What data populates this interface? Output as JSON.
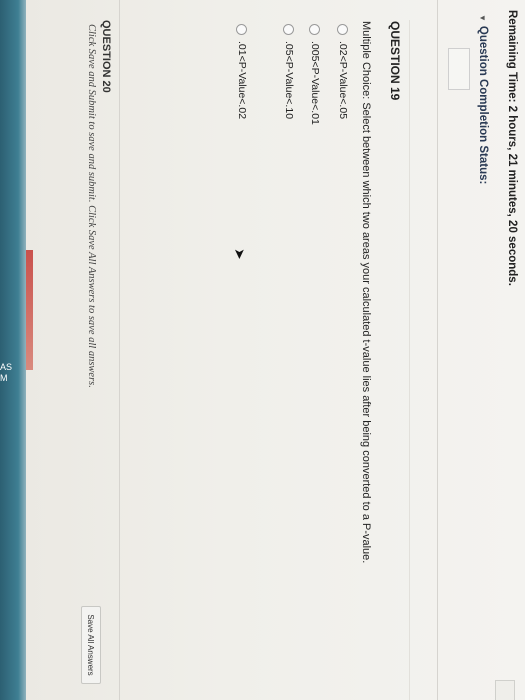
{
  "edge": {
    "text1": "AS",
    "text2": "M"
  },
  "timer": {
    "prefix": "Remaining Time:",
    "value": "2 hours, 21 minutes, 20 seconds."
  },
  "completion_status": {
    "label": "Question Completion Status:"
  },
  "question": {
    "title": "QUESTION 19",
    "text": "Multiple Choice: Select between which two areas your calculated t-value lies after being converted to a P-value.",
    "options": [
      {
        "label": ".02<P-Value<.05"
      },
      {
        "label": ".005<P-Value<.01"
      },
      {
        "label": ".05<P-Value<.10"
      },
      {
        "label": ".01<P-Value<.02"
      }
    ]
  },
  "next_question": {
    "label": "QUESTION 20"
  },
  "footer": {
    "instructions": "Click Save and Submit to save and submit. Click Save All Answers to save all answers.",
    "save_all_label": "Save All Answers"
  }
}
